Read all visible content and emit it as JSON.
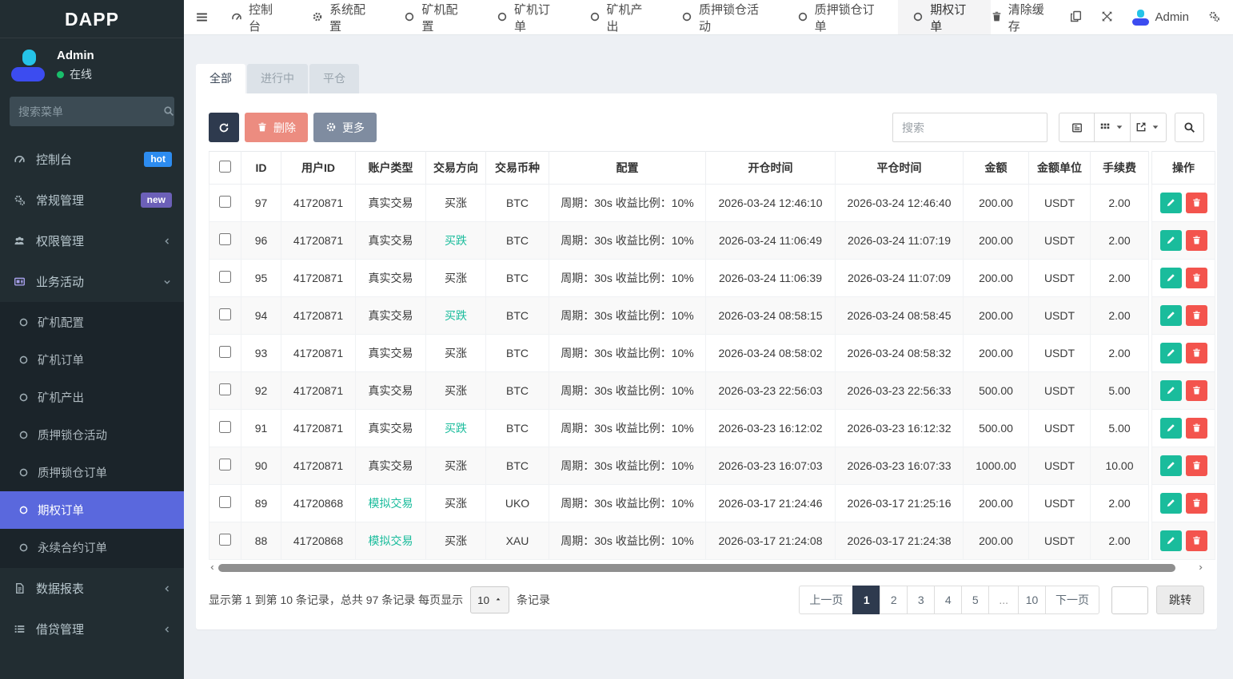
{
  "colors": {
    "sidebar_bg": "#222d32",
    "submenu_bg": "#1b242a",
    "active_menu": "#5a68dd",
    "hot_badge": "#2d8cf0",
    "new_badge": "#6c60b8",
    "online_green": "#19be6b",
    "success": "#1abc9c",
    "danger": "#f3544d",
    "dark_button": "#2e3a4e",
    "delete_button": "#ec8c80",
    "more_button": "#7f8ca0",
    "page_bg": "#edf0f4"
  },
  "sidebar": {
    "logo": "DAPP",
    "user": {
      "name": "Admin",
      "status": "在线"
    },
    "search_placeholder": "搜索菜单",
    "menu": [
      {
        "label": "控制台",
        "icon": "tachometer",
        "badge": "hot"
      },
      {
        "label": "常规管理",
        "icon": "cogs",
        "badge": "new"
      },
      {
        "label": "权限管理",
        "icon": "users",
        "arrow": "left"
      },
      {
        "label": "业务活动",
        "icon": "newspaper",
        "arrow": "down",
        "open": true,
        "children": [
          {
            "label": "矿机配置"
          },
          {
            "label": "矿机订单"
          },
          {
            "label": "矿机产出"
          },
          {
            "label": "质押锁仓活动"
          },
          {
            "label": "质押锁仓订单"
          },
          {
            "label": "期权订单",
            "active": true
          },
          {
            "label": "永续合约订单"
          }
        ]
      },
      {
        "label": "数据报表",
        "icon": "file",
        "arrow": "left"
      },
      {
        "label": "借贷管理",
        "icon": "list",
        "arrow": "left"
      }
    ]
  },
  "topbar": {
    "items": [
      {
        "label": "控制台",
        "icon": "tachometer"
      },
      {
        "label": "系统配置",
        "icon": "gear"
      },
      {
        "label": "矿机配置",
        "icon": "circle"
      },
      {
        "label": "矿机订单",
        "icon": "circle"
      },
      {
        "label": "矿机产出",
        "icon": "circle"
      },
      {
        "label": "质押锁仓活动",
        "icon": "circle"
      },
      {
        "label": "质押锁仓订单",
        "icon": "circle"
      },
      {
        "label": "期权订单",
        "icon": "circle",
        "active": true
      }
    ],
    "clear_cache": "清除缓存",
    "admin": "Admin"
  },
  "tabs": [
    {
      "label": "全部",
      "active": true
    },
    {
      "label": "进行中"
    },
    {
      "label": "平仓"
    }
  ],
  "toolbar": {
    "delete_label": "删除",
    "more_label": "更多",
    "search_placeholder": "搜索"
  },
  "table": {
    "columns": [
      "ID",
      "用户ID",
      "账户类型",
      "交易方向",
      "交易币种",
      "配置",
      "开仓时间",
      "平仓时间",
      "金额",
      "金额单位",
      "手续费",
      "操作"
    ],
    "rows": [
      {
        "id": "97",
        "user_id": "41720871",
        "account_type": "真实交易",
        "direction": "买涨",
        "coin": "BTC",
        "config": "周期：30s 收益比例：10%",
        "open_time": "2026-03-24 12:46:10",
        "close_time": "2026-03-24 12:46:40",
        "amount": "200.00",
        "unit": "USDT",
        "fee": "2.00"
      },
      {
        "id": "96",
        "user_id": "41720871",
        "account_type": "真实交易",
        "direction": "买跌",
        "coin": "BTC",
        "config": "周期：30s 收益比例：10%",
        "open_time": "2026-03-24 11:06:49",
        "close_time": "2026-03-24 11:07:19",
        "amount": "200.00",
        "unit": "USDT",
        "fee": "2.00"
      },
      {
        "id": "95",
        "user_id": "41720871",
        "account_type": "真实交易",
        "direction": "买涨",
        "coin": "BTC",
        "config": "周期：30s 收益比例：10%",
        "open_time": "2026-03-24 11:06:39",
        "close_time": "2026-03-24 11:07:09",
        "amount": "200.00",
        "unit": "USDT",
        "fee": "2.00"
      },
      {
        "id": "94",
        "user_id": "41720871",
        "account_type": "真实交易",
        "direction": "买跌",
        "coin": "BTC",
        "config": "周期：30s 收益比例：10%",
        "open_time": "2026-03-24 08:58:15",
        "close_time": "2026-03-24 08:58:45",
        "amount": "200.00",
        "unit": "USDT",
        "fee": "2.00"
      },
      {
        "id": "93",
        "user_id": "41720871",
        "account_type": "真实交易",
        "direction": "买涨",
        "coin": "BTC",
        "config": "周期：30s 收益比例：10%",
        "open_time": "2026-03-24 08:58:02",
        "close_time": "2026-03-24 08:58:32",
        "amount": "200.00",
        "unit": "USDT",
        "fee": "2.00"
      },
      {
        "id": "92",
        "user_id": "41720871",
        "account_type": "真实交易",
        "direction": "买涨",
        "coin": "BTC",
        "config": "周期：30s 收益比例：10%",
        "open_time": "2026-03-23 22:56:03",
        "close_time": "2026-03-23 22:56:33",
        "amount": "500.00",
        "unit": "USDT",
        "fee": "5.00"
      },
      {
        "id": "91",
        "user_id": "41720871",
        "account_type": "真实交易",
        "direction": "买跌",
        "coin": "BTC",
        "config": "周期：30s 收益比例：10%",
        "open_time": "2026-03-23 16:12:02",
        "close_time": "2026-03-23 16:12:32",
        "amount": "500.00",
        "unit": "USDT",
        "fee": "5.00"
      },
      {
        "id": "90",
        "user_id": "41720871",
        "account_type": "真实交易",
        "direction": "买涨",
        "coin": "BTC",
        "config": "周期：30s 收益比例：10%",
        "open_time": "2026-03-23 16:07:03",
        "close_time": "2026-03-23 16:07:33",
        "amount": "1000.00",
        "unit": "USDT",
        "fee": "10.00"
      },
      {
        "id": "89",
        "user_id": "41720868",
        "account_type": "模拟交易",
        "direction": "买涨",
        "coin": "UKO",
        "config": "周期：30s 收益比例：10%",
        "open_time": "2026-03-17 21:24:46",
        "close_time": "2026-03-17 21:25:16",
        "amount": "200.00",
        "unit": "USDT",
        "fee": "2.00"
      },
      {
        "id": "88",
        "user_id": "41720868",
        "account_type": "模拟交易",
        "direction": "买涨",
        "coin": "XAU",
        "config": "周期：30s 收益比例：10%",
        "open_time": "2026-03-17 21:24:08",
        "close_time": "2026-03-17 21:24:38",
        "amount": "200.00",
        "unit": "USDT",
        "fee": "2.00"
      }
    ]
  },
  "pagination": {
    "info_prefix": "显示第 1 到第 10 条记录，总共 97 条记录 每页显示",
    "page_size": "10",
    "info_suffix": "条记录",
    "pages": [
      "上一页",
      "1",
      "2",
      "3",
      "4",
      "5",
      "...",
      "10",
      "下一页"
    ],
    "active_page": "1",
    "jump_label": "跳转"
  }
}
